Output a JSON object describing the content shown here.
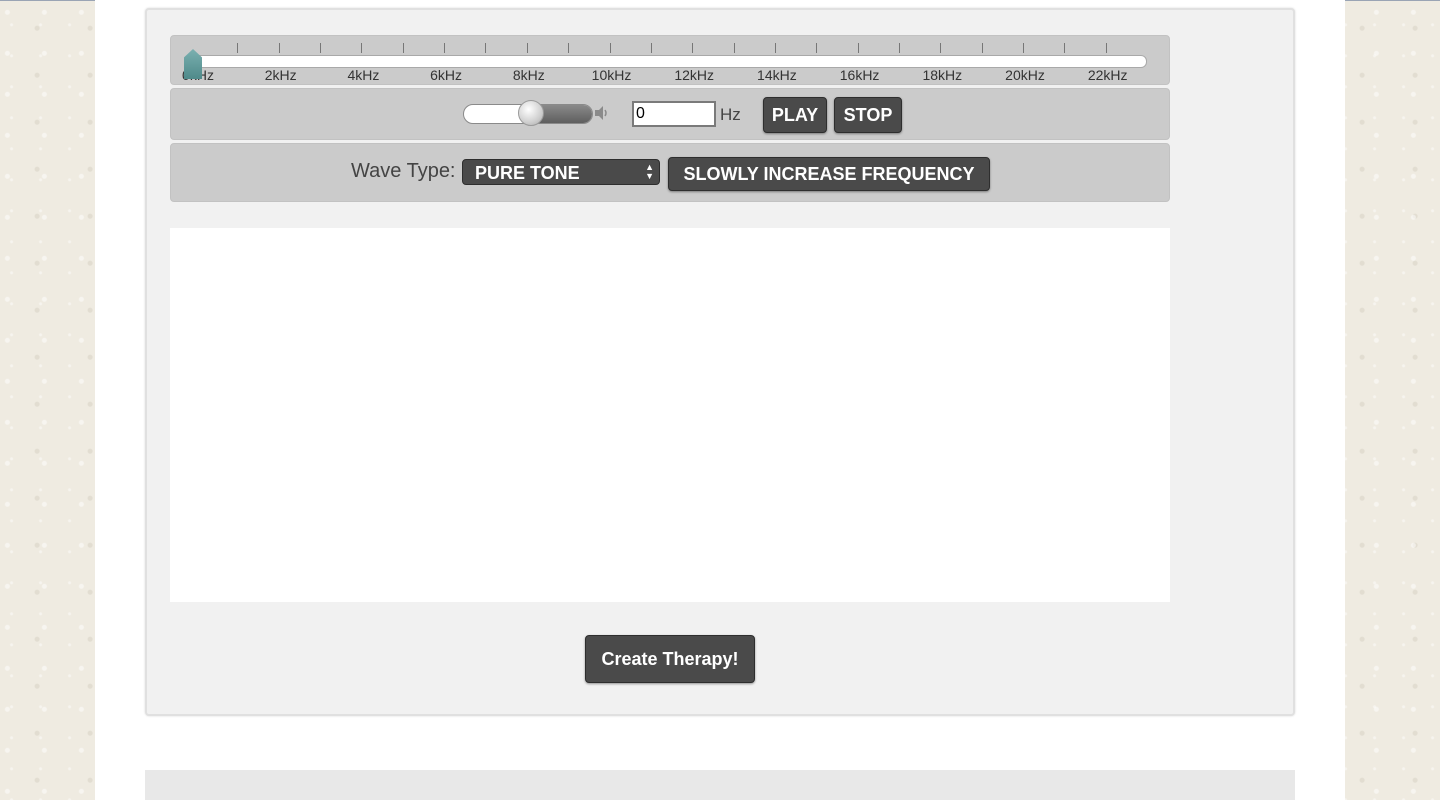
{
  "frequency_slider": {
    "tick_labels": [
      "0kHz",
      "2kHz",
      "4kHz",
      "6kHz",
      "8kHz",
      "10kHz",
      "12kHz",
      "14kHz",
      "16kHz",
      "18kHz",
      "20kHz",
      "22kHz"
    ],
    "value_hz": 0
  },
  "controls": {
    "volume_level": 0.52,
    "frequency_value": "0",
    "unit_label": "Hz",
    "play_label": "PLAY",
    "stop_label": "STOP"
  },
  "wave": {
    "label": "Wave Type:",
    "selected": "PURE TONE",
    "slow_increase_label": "SLOWLY INCREASE FREQUENCY"
  },
  "create_label": "Create Therapy!",
  "colors": {
    "button_bg": "#4a4a4a",
    "thumb": "#5f9a9a",
    "bar_bg": "#cbcbcb"
  }
}
